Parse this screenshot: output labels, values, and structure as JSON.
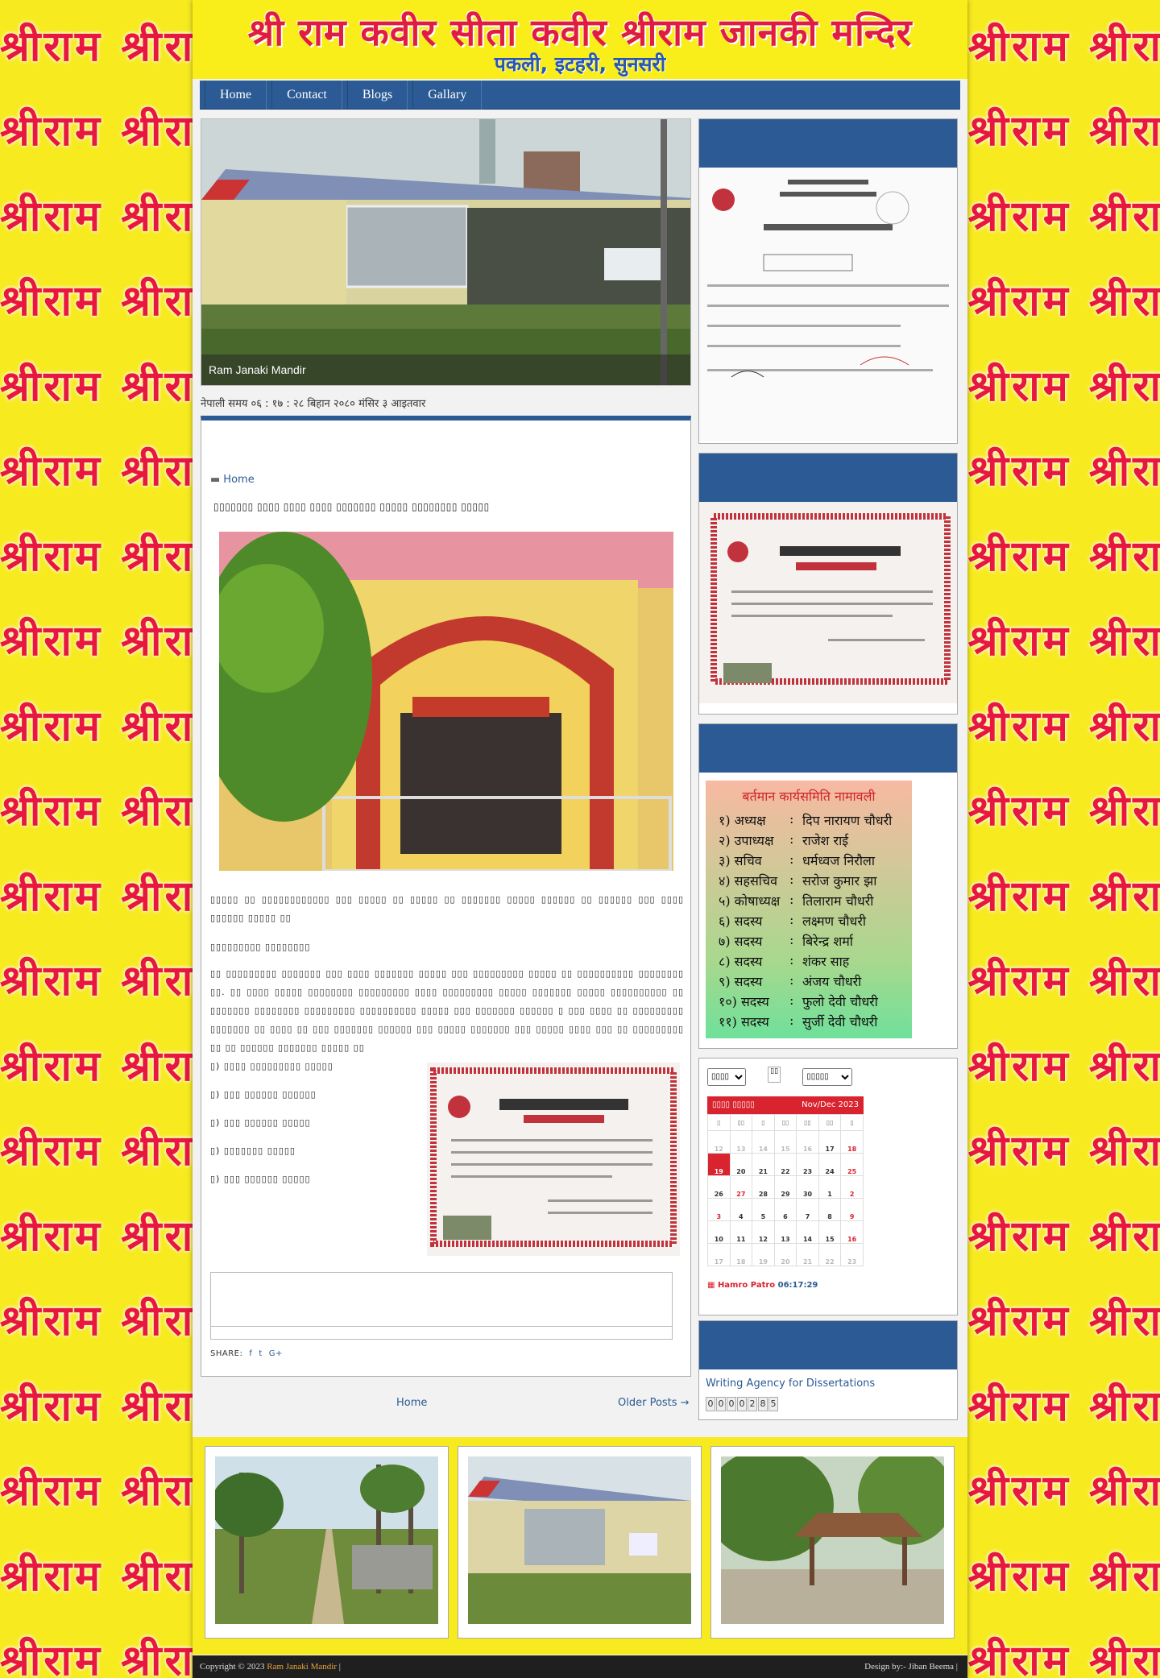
{
  "background": {
    "pattern_text": "श्रीराम श्रीराम श्रीराम श्रीराम श्रीराम श्रीराम श्रीराम श्रीराम श्रीराम श्रीराम श्रीराम श्रीराम",
    "color": "#e8173e",
    "bg": "#f7ea1f"
  },
  "header": {
    "title": "श्री राम कवीर सीता कवीर श्रीराम जानकी मन्दिर",
    "subtitle": "पकली, इटहरी, सुनसरी"
  },
  "nav": {
    "items": [
      {
        "label": "Home"
      },
      {
        "label": "Contact"
      },
      {
        "label": "Blogs"
      },
      {
        "label": "Gallary"
      }
    ]
  },
  "slider": {
    "caption": "Ram Janaki Mandir"
  },
  "nepali_time": "नेपाली समय ०६ : १७ : २८ बिहान   २०८० मंसिर ३ आइतवार",
  "post": {
    "breadcrumb": "Home",
    "title": "▯▯▯▯▯▯▯ ▯▯▯▯ ▯▯▯▯ ▯▯▯▯ ▯▯▯▯▯▯▯ ▯▯▯▯▯ ▯▯▯▯▯▯▯▯ ▯▯▯▯▯",
    "para1": "▯▯▯▯▯ ▯▯ ▯▯▯▯▯▯▯▯▯▯▯▯ ▯▯▯ ▯▯▯▯▯ ▯▯ ▯▯▯▯▯ ▯▯ ▯▯▯▯▯▯▯ ▯▯▯▯▯ ▯▯▯▯▯▯ ▯▯ ▯▯▯▯▯▯ ▯▯▯ ▯▯▯▯ ▯▯▯▯▯▯ ▯▯▯▯▯ ▯▯",
    "para2": "▯▯▯▯▯▯▯▯▯ ▯▯▯▯▯▯▯▯",
    "para3": "▯▯ ▯▯▯▯▯▯▯▯▯ ▯▯▯▯▯▯▯ ▯▯▯ ▯▯▯▯ ▯▯▯▯▯▯▯ ▯▯▯▯▯ ▯▯▯ ▯▯▯▯▯▯▯▯▯ ▯▯▯▯▯ ▯▯ ▯▯▯▯▯▯▯▯▯▯ ▯▯▯▯▯▯▯▯ ▯▯. ▯▯ ▯▯▯▯ ▯▯▯▯▯ ▯▯▯▯▯▯▯▯ ▯▯▯▯▯▯▯▯▯ ▯▯▯▯ ▯▯▯▯▯▯▯▯▯ ▯▯▯▯▯ ▯▯▯▯▯▯▯ ▯▯▯▯▯ ▯▯▯▯▯▯▯▯▯▯ ▯▯ ▯▯▯▯▯▯▯ ▯▯▯▯▯▯▯▯ ▯▯▯▯▯▯▯▯▯ ▯▯▯▯▯▯▯▯▯▯ ▯▯▯▯▯ ▯▯▯ ▯▯▯▯▯▯▯ ▯▯▯▯▯▯ ▯ ▯▯▯ ▯▯▯▯ ▯▯ ▯▯▯▯▯▯▯▯▯ ▯▯▯▯▯▯▯ ▯▯ ▯▯▯▯ ▯▯ ▯▯▯ ▯▯▯▯▯▯▯ ▯▯▯▯▯▯ ▯▯▯ ▯▯▯▯▯ ▯▯▯▯▯▯▯ ▯▯▯ ▯▯▯▯▯ ▯▯▯▯ ▯▯▯ ▯▯ ▯▯▯▯▯▯▯▯▯ ▯▯ ▯▯ ▯▯▯▯▯▯ ▯▯▯▯▯▯▯ ▯▯▯▯▯ ▯▯",
    "list": [
      "▯) ▯▯▯▯ ▯▯▯▯▯▯▯▯▯ ▯▯▯▯▯",
      "▯) ▯▯▯ ▯▯▯▯▯▯ ▯▯▯▯▯▯",
      "▯) ▯▯▯ ▯▯▯▯▯▯ ▯▯▯▯▯",
      "▯) ▯▯▯▯▯▯▯ ▯▯▯▯▯",
      "▯) ▯▯▯ ▯▯▯▯▯▯ ▯▯▯▯▯"
    ],
    "share_label": "SHARE:",
    "share_icons": [
      "facebook-icon",
      "twitter-icon",
      "google-plus-icon"
    ]
  },
  "pager": {
    "home": "Home",
    "older": "Older Posts →"
  },
  "sidebar": {
    "committee": {
      "title": "बर्तमान कार्यसमिति नामावली",
      "members": [
        {
          "role": "१) अध्यक्ष",
          "name": "दिप नारायण चौधरी"
        },
        {
          "role": "२) उपाध्यक्ष",
          "name": "राजेश राई"
        },
        {
          "role": "३) सचिव",
          "name": "धर्मध्वज निरौला"
        },
        {
          "role": "४) सहसचिव",
          "name": "सरोज कुमार झा"
        },
        {
          "role": "५) कोषाध्यक्ष",
          "name": "तिलाराम चौधरी"
        },
        {
          "role": "६) सदस्य",
          "name": "लक्ष्मण चौधरी"
        },
        {
          "role": "७) सदस्य",
          "name": "बिरेन्द्र शर्मा"
        },
        {
          "role": "८) सदस्य",
          "name": "शंकर साह"
        },
        {
          "role": "९) सदस्य",
          "name": "अंजय चौधरी"
        },
        {
          "role": "१०) सदस्य",
          "name": "फुलो देवी चौधरी"
        },
        {
          "role": "११) सदस्य",
          "name": "सुर्जी देवी चौधरी"
        }
      ]
    },
    "calendar": {
      "select1": "▯▯▯▯",
      "go": "▯▯",
      "select2": "▯▯▯▯▯",
      "month_left": "▯▯▯▯ ▯▯▯▯▯",
      "month_right": "Nov/Dec 2023",
      "weekdays": [
        "▯",
        "▯▯",
        "▯",
        "▯▯",
        "▯▯",
        "▯▯",
        "▯"
      ],
      "rows": [
        [
          "12",
          "13",
          "14",
          "15",
          "16",
          "17",
          "18"
        ],
        [
          "19",
          "20",
          "21",
          "22",
          "23",
          "24",
          "25"
        ],
        [
          "26",
          "27",
          "28",
          "29",
          "30",
          "1",
          "2"
        ],
        [
          "3",
          "4",
          "5",
          "6",
          "7",
          "8",
          "9"
        ],
        [
          "10",
          "11",
          "12",
          "13",
          "14",
          "15",
          "16"
        ],
        [
          "17",
          "18",
          "19",
          "20",
          "21",
          "22",
          "23"
        ]
      ],
      "brand": "Hamro Patro",
      "time": "06:17:29"
    },
    "writing_link": "Writing Agency for Dissertations",
    "counter": [
      "0",
      "0",
      "0",
      "0",
      "2",
      "8",
      "5"
    ]
  },
  "footer": {
    "copyright": "Copyright © 2023",
    "site_link": "Ram Janaki Mandir",
    "sep": "|",
    "design": "Design by:- Jiban Beema |"
  }
}
